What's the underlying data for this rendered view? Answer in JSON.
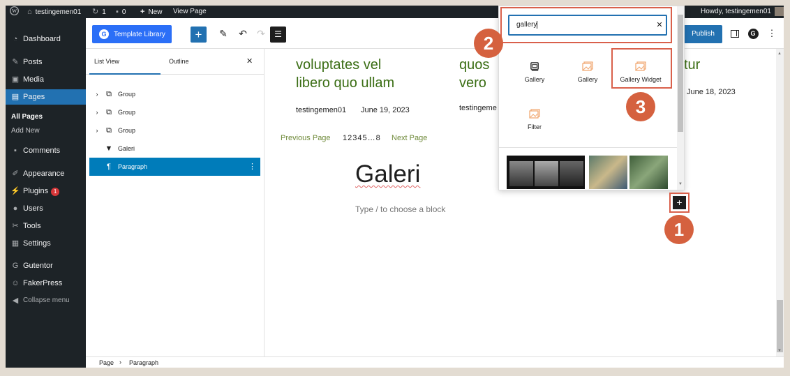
{
  "admin_bar": {
    "site_name": "testingemen01",
    "updates_count": "1",
    "comments_count": "0",
    "new_label": "New",
    "view_page_label": "View Page",
    "howdy": "Howdy, testingemen01"
  },
  "sidebar": {
    "dashboard": "Dashboard",
    "posts": "Posts",
    "media": "Media",
    "pages": "Pages",
    "all_pages": "All Pages",
    "add_new": "Add New",
    "comments": "Comments",
    "appearance": "Appearance",
    "plugins": "Plugins",
    "plugins_badge": "1",
    "users": "Users",
    "tools": "Tools",
    "settings": "Settings",
    "gutentor": "Gutentor",
    "fakerpress": "FakerPress",
    "collapse": "Collapse menu"
  },
  "toolbar": {
    "template_library": "Template Library",
    "add_icon": "+",
    "publish": "Publish"
  },
  "list_view": {
    "tab_list": "List View",
    "tab_outline": "Outline",
    "close": "✕",
    "items": [
      {
        "label": "Group"
      },
      {
        "label": "Group"
      },
      {
        "label": "Group"
      },
      {
        "label": "Galeri"
      },
      {
        "label": "Paragraph"
      }
    ]
  },
  "canvas": {
    "post1_title_line1": "voluptates vel",
    "post1_title_line2": "libero quo ullam",
    "post1_author": "testingemen01",
    "post1_date": "June 19, 2023",
    "post2_title_line1": "quos",
    "post2_title_line2": "vero",
    "post2_author": "testingeme",
    "post3_title_fragment": "tur",
    "post3_date": "June 18, 2023",
    "prev_page": "Previous Page",
    "page_numbers": "12345…8",
    "next_page": "Next Page",
    "heading": "Galeri",
    "placeholder": "Type / to choose a block"
  },
  "inserter": {
    "search_value": "gallery",
    "clear": "✕",
    "blocks": [
      {
        "label": "Gallery",
        "icon": "gallery-core-icon"
      },
      {
        "label": "Gallery",
        "icon": "gallery-gutentor-icon"
      },
      {
        "label": "Gallery Widget",
        "icon": "gallery-widget-icon"
      },
      {
        "label": "Filter",
        "icon": "filter-gallery-icon"
      }
    ]
  },
  "annotations": {
    "step1": "1",
    "step2": "2",
    "step3": "3"
  },
  "footer": {
    "crumb_page": "Page",
    "crumb_sep": "›",
    "crumb_paragraph": "Paragraph"
  },
  "colors": {
    "accent": "#2271b1",
    "annotation": "#d9604b",
    "admin_bg": "#1d2327",
    "title_green": "#3b6e15"
  }
}
